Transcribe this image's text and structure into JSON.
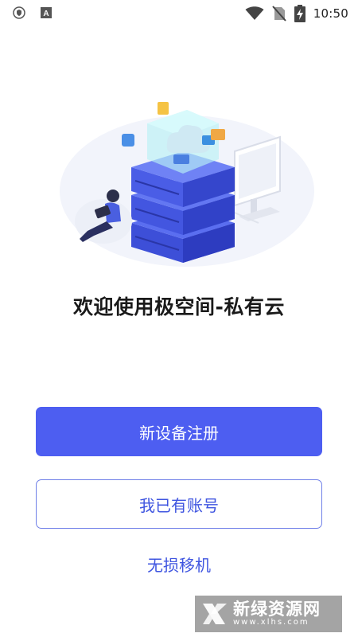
{
  "status_bar": {
    "time": "10:50",
    "left_icons": [
      "shield-icon",
      "a-letter-icon"
    ],
    "right_icons": [
      "wifi-icon",
      "no-sim-icon",
      "battery-charging-icon"
    ]
  },
  "welcome": {
    "title": "欢迎使用极空间-私有云"
  },
  "actions": {
    "register_label": "新设备注册",
    "login_label": "我已有账号",
    "migrate_label": "无损移机"
  },
  "watermark": {
    "title": "新绿资源网",
    "url": "www.xlhs.com"
  },
  "colors": {
    "primary": "#4d5ef1",
    "link": "#3f55e0",
    "outline_border": "#6f7fe8",
    "text": "#1a1a1a"
  }
}
